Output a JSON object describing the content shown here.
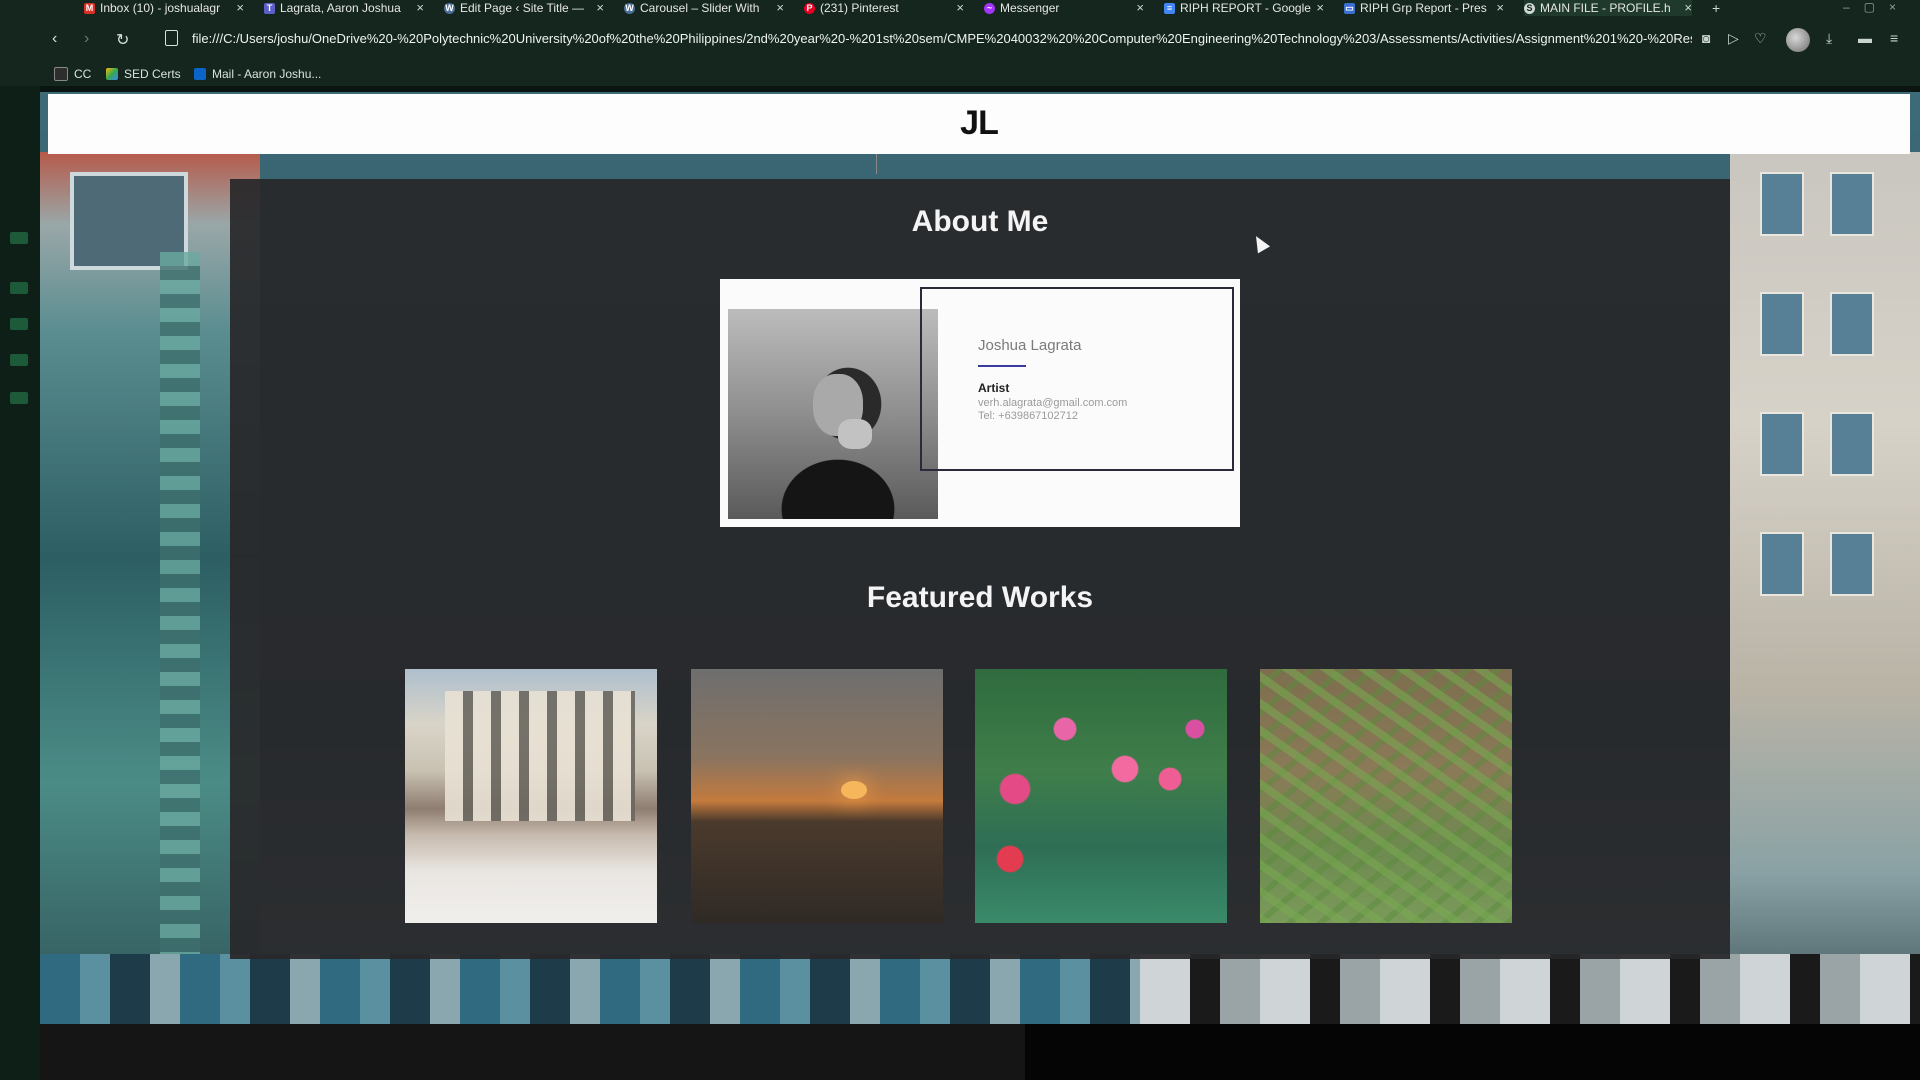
{
  "browser": {
    "tabs": [
      {
        "label": "Inbox (10) - joshualagr",
        "icon": "gmail-icon",
        "color": "#d93025"
      },
      {
        "label": "Lagrata, Aaron Joshua",
        "icon": "teams-icon",
        "color": "#5b5fc7"
      },
      {
        "label": "Edit Page ‹ Site Title —",
        "icon": "wordpress-icon",
        "color": "#4a6e9a"
      },
      {
        "label": "Carousel – Slider With",
        "icon": "wordpress-icon",
        "color": "#4a6e9a"
      },
      {
        "label": "(231) Pinterest",
        "icon": "pinterest-icon",
        "color": "#e60023"
      },
      {
        "label": "Messenger",
        "icon": "messenger-icon",
        "color": "#a334fa"
      },
      {
        "label": "RIPH REPORT - Google",
        "icon": "docs-icon",
        "color": "#4285f4"
      },
      {
        "label": "RIPH Grp Report - Pres",
        "icon": "slides-icon",
        "color": "#3b6fd1"
      },
      {
        "label": "MAIN FILE - PROFILE.h",
        "icon": "file-icon",
        "color": "#cfd8d3"
      }
    ],
    "url": "file:///C:/Users/joshu/OneDrive%20-%20Polytechnic%20University%20of%20the%20Philippines/2nd%20year%20-%201st%20sem/CMPE%2040032%20%20Computer%20Engineering%20Technology%203/Assessments/Activities/Assignment%201%20-%20Res",
    "bookmarks": [
      {
        "label": "CC",
        "icon": "cc-icon"
      },
      {
        "label": "SED Certs",
        "icon": "drive-icon"
      },
      {
        "label": "Mail - Aaron Joshu...",
        "icon": "outlook-icon"
      }
    ]
  },
  "site": {
    "logo": "JL",
    "about_title": "About Me",
    "card": {
      "name": "Joshua Lagrata",
      "role": "Artist",
      "email": "verh.alagrata@gmail.com.com",
      "tel": "Tel: +639867102712"
    },
    "featured_title": "Featured Works",
    "works": [
      "building-photo",
      "sunset-photo",
      "flowers-photo",
      "plants-photo"
    ]
  }
}
